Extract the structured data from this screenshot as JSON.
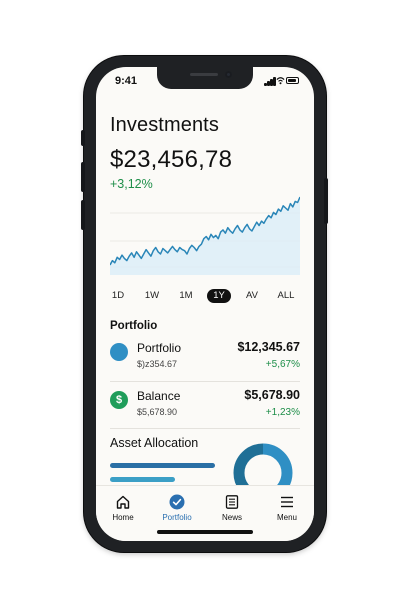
{
  "status": {
    "time": "9:41"
  },
  "header": {
    "title": "Investments",
    "total_value": "$23,456,78",
    "change": "+3,12%"
  },
  "chart_data": {
    "type": "area",
    "title": "",
    "xlabel": "",
    "ylabel": "",
    "grid": true,
    "x": [
      0,
      1,
      2,
      3,
      4,
      5,
      6,
      7,
      8,
      9,
      10,
      11,
      12,
      13,
      14,
      15,
      16,
      17,
      18,
      19,
      20,
      21,
      22,
      23,
      24,
      25,
      26,
      27,
      28,
      29,
      30,
      31,
      32,
      33,
      34,
      35,
      36,
      37,
      38,
      39,
      40,
      41,
      42,
      43,
      44,
      45,
      46,
      47,
      48,
      49,
      50,
      51,
      52,
      53,
      54,
      55,
      56,
      57,
      58,
      59,
      60,
      61,
      62,
      63,
      64,
      65,
      66,
      67,
      68,
      69,
      70,
      71,
      72,
      73,
      74,
      75,
      76,
      77,
      78,
      79
    ],
    "values": [
      10,
      14,
      12,
      17,
      15,
      19,
      16,
      14,
      18,
      21,
      17,
      22,
      19,
      16,
      20,
      24,
      21,
      18,
      23,
      26,
      22,
      20,
      25,
      23,
      21,
      24,
      27,
      24,
      22,
      26,
      24,
      23,
      20,
      25,
      28,
      26,
      23,
      27,
      29,
      34,
      36,
      33,
      38,
      35,
      37,
      34,
      40,
      42,
      39,
      44,
      41,
      39,
      43,
      46,
      42,
      40,
      44,
      47,
      43,
      41,
      45,
      49,
      46,
      50,
      48,
      52,
      55,
      53,
      58,
      56,
      61,
      59,
      64,
      62,
      60,
      66,
      63,
      68,
      67,
      72
    ],
    "color": "#2a86b8",
    "fill": "#dbeef7"
  },
  "ranges": {
    "items": [
      "1D",
      "1W",
      "1M",
      "1Y",
      "AV",
      "ALL"
    ],
    "active": "1Y"
  },
  "portfolio": {
    "title": "Portfolio",
    "rows": [
      {
        "name": "Portfolio",
        "sub": "$)z354.67",
        "amount": "$12,345.67",
        "pct": "+5,67%",
        "icon": "circle-icon",
        "color": "#2f8fc4"
      },
      {
        "name": "Balance",
        "sub": "$5,678.90",
        "amount": "$5,678.90",
        "pct": "+1,23%",
        "icon": "dollar-icon",
        "color": "#1f9d5a"
      }
    ]
  },
  "allocation": {
    "title": "Asset Allocation",
    "bars": [
      {
        "fraction": 0.55,
        "color": "#2a6fa5"
      },
      {
        "fraction": 0.34,
        "color": "#3b9fc6"
      }
    ],
    "donut": [
      {
        "fraction": 0.42,
        "color": "#2f8fc4"
      },
      {
        "fraction": 0.12,
        "color": "#2fb38a"
      },
      {
        "fraction": 0.46,
        "color": "#1f6f96"
      }
    ]
  },
  "tabbar": {
    "items": [
      {
        "label": "Home",
        "icon": "home-icon"
      },
      {
        "label": "Portfolio",
        "icon": "check-circle-icon"
      },
      {
        "label": "News",
        "icon": "news-icon"
      },
      {
        "label": "Menu",
        "icon": "menu-icon"
      }
    ],
    "active": "Portfolio",
    "accent": "#2a6fb0"
  }
}
